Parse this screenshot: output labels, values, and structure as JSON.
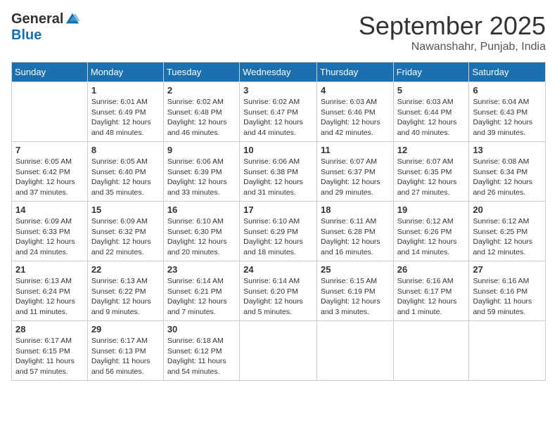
{
  "logo": {
    "general": "General",
    "blue": "Blue"
  },
  "title": "September 2025",
  "location": "Nawanshahr, Punjab, India",
  "days_of_week": [
    "Sunday",
    "Monday",
    "Tuesday",
    "Wednesday",
    "Thursday",
    "Friday",
    "Saturday"
  ],
  "weeks": [
    [
      {
        "day": "",
        "info": ""
      },
      {
        "day": "1",
        "info": "Sunrise: 6:01 AM\nSunset: 6:49 PM\nDaylight: 12 hours\nand 48 minutes."
      },
      {
        "day": "2",
        "info": "Sunrise: 6:02 AM\nSunset: 6:48 PM\nDaylight: 12 hours\nand 46 minutes."
      },
      {
        "day": "3",
        "info": "Sunrise: 6:02 AM\nSunset: 6:47 PM\nDaylight: 12 hours\nand 44 minutes."
      },
      {
        "day": "4",
        "info": "Sunrise: 6:03 AM\nSunset: 6:46 PM\nDaylight: 12 hours\nand 42 minutes."
      },
      {
        "day": "5",
        "info": "Sunrise: 6:03 AM\nSunset: 6:44 PM\nDaylight: 12 hours\nand 40 minutes."
      },
      {
        "day": "6",
        "info": "Sunrise: 6:04 AM\nSunset: 6:43 PM\nDaylight: 12 hours\nand 39 minutes."
      }
    ],
    [
      {
        "day": "7",
        "info": "Sunrise: 6:05 AM\nSunset: 6:42 PM\nDaylight: 12 hours\nand 37 minutes."
      },
      {
        "day": "8",
        "info": "Sunrise: 6:05 AM\nSunset: 6:40 PM\nDaylight: 12 hours\nand 35 minutes."
      },
      {
        "day": "9",
        "info": "Sunrise: 6:06 AM\nSunset: 6:39 PM\nDaylight: 12 hours\nand 33 minutes."
      },
      {
        "day": "10",
        "info": "Sunrise: 6:06 AM\nSunset: 6:38 PM\nDaylight: 12 hours\nand 31 minutes."
      },
      {
        "day": "11",
        "info": "Sunrise: 6:07 AM\nSunset: 6:37 PM\nDaylight: 12 hours\nand 29 minutes."
      },
      {
        "day": "12",
        "info": "Sunrise: 6:07 AM\nSunset: 6:35 PM\nDaylight: 12 hours\nand 27 minutes."
      },
      {
        "day": "13",
        "info": "Sunrise: 6:08 AM\nSunset: 6:34 PM\nDaylight: 12 hours\nand 26 minutes."
      }
    ],
    [
      {
        "day": "14",
        "info": "Sunrise: 6:09 AM\nSunset: 6:33 PM\nDaylight: 12 hours\nand 24 minutes."
      },
      {
        "day": "15",
        "info": "Sunrise: 6:09 AM\nSunset: 6:32 PM\nDaylight: 12 hours\nand 22 minutes."
      },
      {
        "day": "16",
        "info": "Sunrise: 6:10 AM\nSunset: 6:30 PM\nDaylight: 12 hours\nand 20 minutes."
      },
      {
        "day": "17",
        "info": "Sunrise: 6:10 AM\nSunset: 6:29 PM\nDaylight: 12 hours\nand 18 minutes."
      },
      {
        "day": "18",
        "info": "Sunrise: 6:11 AM\nSunset: 6:28 PM\nDaylight: 12 hours\nand 16 minutes."
      },
      {
        "day": "19",
        "info": "Sunrise: 6:12 AM\nSunset: 6:26 PM\nDaylight: 12 hours\nand 14 minutes."
      },
      {
        "day": "20",
        "info": "Sunrise: 6:12 AM\nSunset: 6:25 PM\nDaylight: 12 hours\nand 12 minutes."
      }
    ],
    [
      {
        "day": "21",
        "info": "Sunrise: 6:13 AM\nSunset: 6:24 PM\nDaylight: 12 hours\nand 11 minutes."
      },
      {
        "day": "22",
        "info": "Sunrise: 6:13 AM\nSunset: 6:22 PM\nDaylight: 12 hours\nand 9 minutes."
      },
      {
        "day": "23",
        "info": "Sunrise: 6:14 AM\nSunset: 6:21 PM\nDaylight: 12 hours\nand 7 minutes."
      },
      {
        "day": "24",
        "info": "Sunrise: 6:14 AM\nSunset: 6:20 PM\nDaylight: 12 hours\nand 5 minutes."
      },
      {
        "day": "25",
        "info": "Sunrise: 6:15 AM\nSunset: 6:19 PM\nDaylight: 12 hours\nand 3 minutes."
      },
      {
        "day": "26",
        "info": "Sunrise: 6:16 AM\nSunset: 6:17 PM\nDaylight: 12 hours\nand 1 minute."
      },
      {
        "day": "27",
        "info": "Sunrise: 6:16 AM\nSunset: 6:16 PM\nDaylight: 11 hours\nand 59 minutes."
      }
    ],
    [
      {
        "day": "28",
        "info": "Sunrise: 6:17 AM\nSunset: 6:15 PM\nDaylight: 11 hours\nand 57 minutes."
      },
      {
        "day": "29",
        "info": "Sunrise: 6:17 AM\nSunset: 6:13 PM\nDaylight: 11 hours\nand 56 minutes."
      },
      {
        "day": "30",
        "info": "Sunrise: 6:18 AM\nSunset: 6:12 PM\nDaylight: 11 hours\nand 54 minutes."
      },
      {
        "day": "",
        "info": ""
      },
      {
        "day": "",
        "info": ""
      },
      {
        "day": "",
        "info": ""
      },
      {
        "day": "",
        "info": ""
      }
    ]
  ]
}
